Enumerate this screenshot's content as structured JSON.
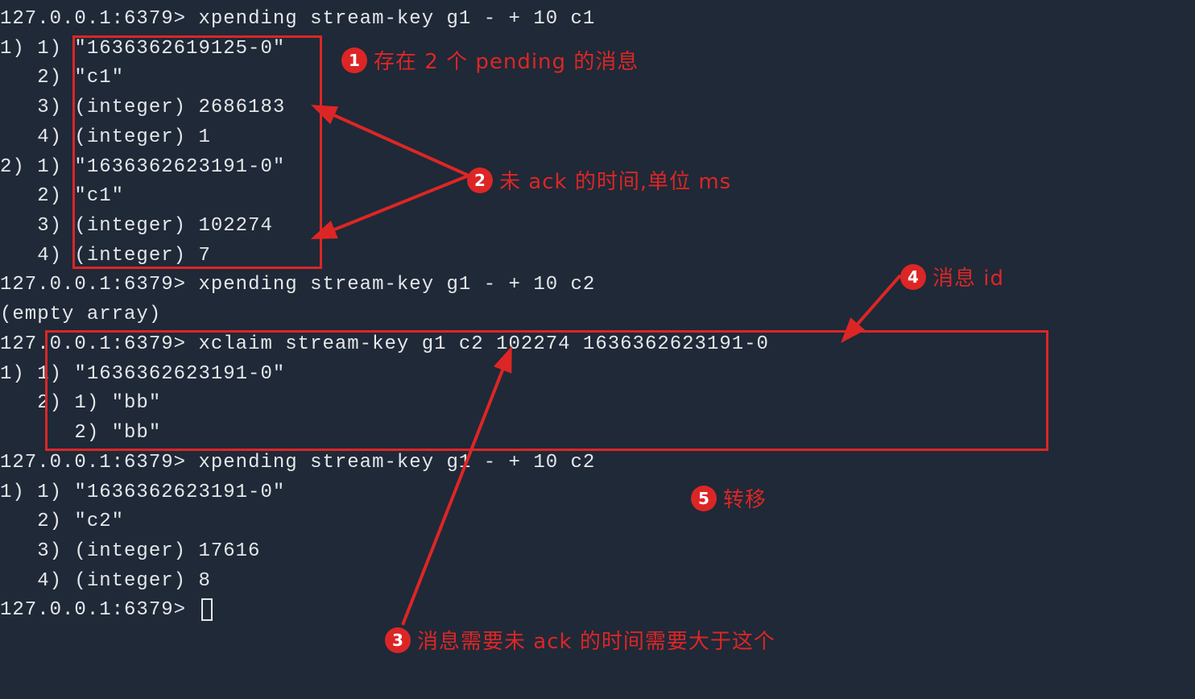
{
  "prompt": "127.0.0.1:6379>",
  "commands": {
    "cmd1": "xpending stream-key g1 - + 10 c1",
    "cmd2": "xpending stream-key g1 - + 10 c2",
    "cmd3": "xclaim stream-key g1 c2 102274 1636362623191-0",
    "cmd4": "xpending stream-key g1 - + 10 c2"
  },
  "output1": {
    "l1": "1) 1) \"1636362619125-0\"",
    "l2": "   2) \"c1\"",
    "l3": "   3) (integer) 2686183",
    "l4": "   4) (integer) 1",
    "l5": "2) 1) \"1636362623191-0\"",
    "l6": "   2) \"c1\"",
    "l7": "   3) (integer) 102274",
    "l8": "   4) (integer) 7"
  },
  "output2": "(empty array)",
  "output3": {
    "l1": "1) 1) \"1636362623191-0\"",
    "l2": "   2) 1) \"bb\"",
    "l3": "      2) \"bb\""
  },
  "output4": {
    "l1": "1) 1) \"1636362623191-0\"",
    "l2": "   2) \"c2\"",
    "l3": "   3) (integer) 17616",
    "l4": "   4) (integer) 8"
  },
  "annotations": {
    "a1": {
      "num": "1",
      "text": "存在 2 个 pending 的消息"
    },
    "a2": {
      "num": "2",
      "text": "未 ack 的时间,单位 ms"
    },
    "a3": {
      "num": "3",
      "text": "消息需要未 ack 的时间需要大于这个"
    },
    "a4": {
      "num": "4",
      "text": "消息 id"
    },
    "a5": {
      "num": "5",
      "text": "转移"
    }
  }
}
